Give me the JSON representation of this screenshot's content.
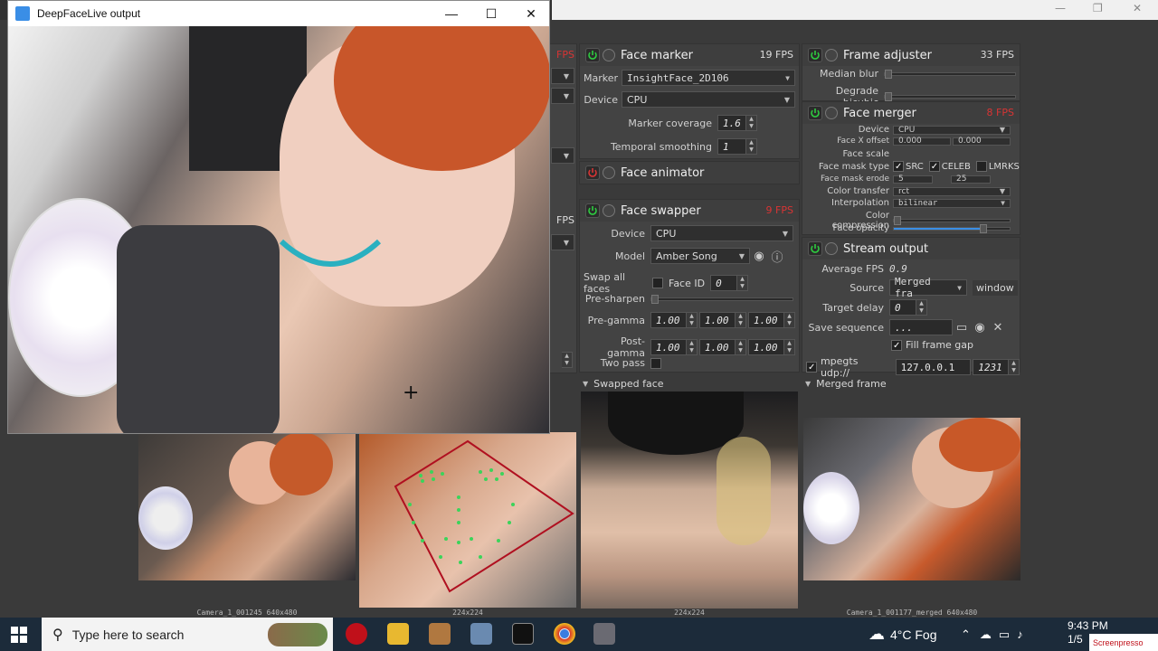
{
  "app_window": {
    "controls": [
      "—",
      "❐",
      "✕"
    ]
  },
  "output_window": {
    "title": "DeepFaceLive output",
    "controls": {
      "minimize": "—",
      "maximize": "☐",
      "close": "✕"
    }
  },
  "left_partial": {
    "fps_top": "FPS",
    "fps_mid": "FPS"
  },
  "face_marker": {
    "title": "Face marker",
    "fps": "19 FPS",
    "marker_label": "Marker",
    "marker_value": "InsightFace_2D106",
    "device_label": "Device",
    "device_value": "CPU",
    "coverage_label": "Marker coverage",
    "coverage_value": "1.6",
    "smoothing_label": "Temporal smoothing",
    "smoothing_value": "1"
  },
  "face_animator": {
    "title": "Face animator"
  },
  "face_swapper": {
    "title": "Face swapper",
    "fps": "9 FPS",
    "device_label": "Device",
    "device_value": "CPU",
    "model_label": "Model",
    "model_value": "Amber Song",
    "swap_all_label": "Swap all faces",
    "face_id_label": "Face ID",
    "face_id_value": "0",
    "presharpen_label": "Pre-sharpen",
    "pregamma_label": "Pre-gamma",
    "pregamma_values": [
      "1.00",
      "1.00",
      "1.00"
    ],
    "postgamma_label": "Post-gamma",
    "postgamma_values": [
      "1.00",
      "1.00",
      "1.00"
    ],
    "twopass_label": "Two pass"
  },
  "frame_adjuster": {
    "title": "Frame adjuster",
    "fps": "33 FPS",
    "median_label": "Median blur",
    "degrade_label": "Degrade bicubic"
  },
  "face_merger": {
    "title": "Face merger",
    "fps": "8 FPS",
    "device_label": "Device",
    "device_value": "CPU",
    "offset_label": "Face X offset",
    "offset_values": [
      "0.000",
      "0.000"
    ],
    "scale_label": "Face scale",
    "masktype_label": "Face mask type",
    "mask_src": "SRC",
    "mask_celeb": "CELEB",
    "mask_lmrks": "LMRKS",
    "erode_label": "Face mask erode",
    "erode_values": [
      "5",
      "25"
    ],
    "color_transfer_label": "Color transfer",
    "color_transfer_value": "rct",
    "interp_label": "Interpolation",
    "interp_value": "bilinear",
    "compression_label": "Color compression",
    "opacity_label": "Face opacity"
  },
  "stream_output": {
    "title": "Stream output",
    "avgfps_label": "Average FPS",
    "avgfps_value": "0.9",
    "source_label": "Source",
    "source_value": "Merged fra",
    "window_button": "window",
    "delay_label": "Target delay",
    "delay_value": "0",
    "save_label": "Save sequence",
    "save_value": "...",
    "fill_gap_label": "Fill frame gap",
    "mpegts_label": "mpegts udp://",
    "mpegts_host": "127.0.0.1",
    "mpegts_port": "1231"
  },
  "preview_headers": {
    "swapped": "Swapped face",
    "merged": "Merged frame"
  },
  "captions": {
    "camera": "Camera_1_001245 640x480",
    "aligned": "224x224",
    "swapped": "224x224",
    "merged": "Camera_1_001177_merged 640x480"
  },
  "taskbar": {
    "search_placeholder": "Type here to search",
    "weather": "4°C  Fog",
    "time": "9:43 PM",
    "date": "1/5",
    "watermark": "Screenpresso"
  },
  "colors": {
    "power_green": "#2ecc40",
    "power_red": "#d83434",
    "panel": "#434343",
    "fps_red": "#d83434"
  }
}
